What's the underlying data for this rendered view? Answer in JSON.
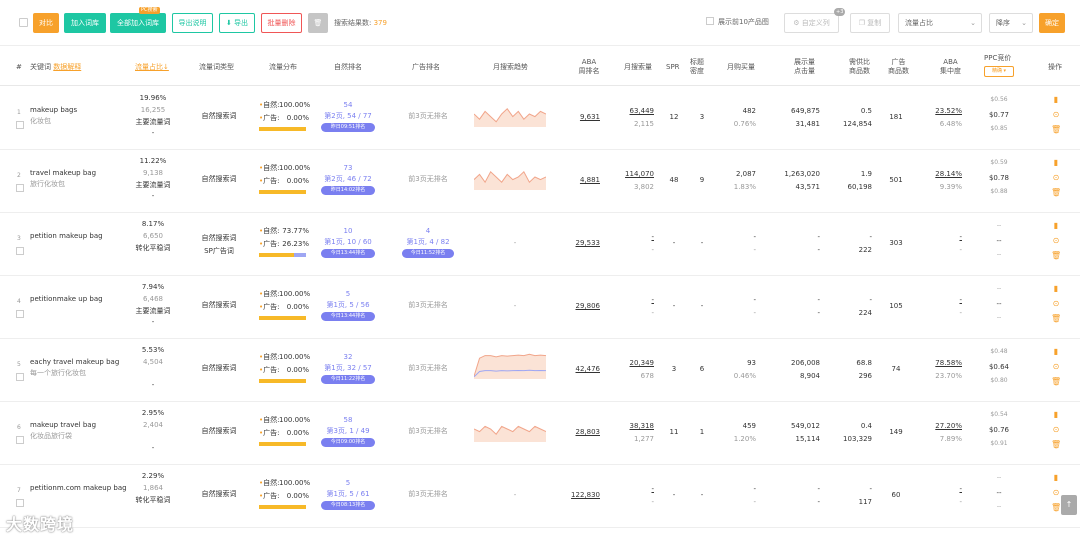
{
  "toolbar": {
    "btn_back": "对比",
    "btn_add_lib": "加入词库",
    "btn_add_all": "全部加入词库",
    "btn_export_note": "导出说明",
    "btn_export": "导出",
    "btn_batch_delete": "批量删除",
    "result_label": "搜索结果数:",
    "result_count": "379",
    "top10_label": "展示前10产品图",
    "btn_custom": "自定义列",
    "custom_badge": "+3",
    "btn_copy": "复制",
    "sort_field": "流量占比",
    "sort_order": "降序",
    "btn_confirm": "确定"
  },
  "headers": {
    "idx": "#",
    "keyword": "关键词",
    "keyword_link": "数据解释",
    "share": "流量占比",
    "share_tag": "PC搜索",
    "share_arrow": "↓",
    "type": "流量词类型",
    "dist": "流量分布",
    "organic_rank": "自然排名",
    "ad_rank": "广告排名",
    "trend": "月搜索趋势",
    "aba1": "ABA",
    "aba2": "周排名",
    "monthly_search": "月搜索量",
    "spr": "SPR",
    "title_density1": "标题",
    "title_density2": "密度",
    "monthly_purchase": "月购买量",
    "impressions1": "展示量",
    "impressions2": "点击量",
    "supply1": "需供比",
    "supply2": "商品数",
    "ad1": "广告",
    "ad2": "商品数",
    "aba_focus1": "ABA",
    "aba_focus2": "集中度",
    "ppc": "PPC竞价",
    "ppc_btn": "精确 ▾",
    "action": "操作"
  },
  "rows": [
    {
      "idx": "1",
      "kw": "makeup bags",
      "kw_cn": "化妆包",
      "share": "19.96%",
      "share_num": "16,255",
      "share_type": "主要流量词",
      "share_extra": "-",
      "type": "自然搜索词",
      "type2": "",
      "nat_label": "自然:",
      "nat": "100.00%",
      "ad_label": "广告:",
      "ad": "0.00%",
      "nat_frac": 1.0,
      "rank_top": "54",
      "rank_mid": "第2页, 54 / 77",
      "rank_pill": "昨日09:51排名",
      "ad_rank_top": "",
      "ad_rank_mid": "前3页无排名",
      "ad_rank_pill": "",
      "aba": "9,631",
      "ms1": "63,449",
      "ms2": "2,115",
      "spr": "12",
      "density": "3",
      "mp1": "482",
      "mp2": "0.76%",
      "im1": "649,875",
      "im2": "31,481",
      "sp1": "0.5",
      "sp2": "124,854",
      "adc": "181",
      "af1": "23.52%",
      "af2": "6.48%",
      "ppc1": "$0.56",
      "ppc2": "$0.77",
      "ppc3": "$0.85",
      "trend": [
        0.5,
        0.3,
        0.6,
        0.4,
        0.2,
        0.5,
        0.7,
        0.4,
        0.6,
        0.3,
        0.5,
        0.4,
        0.6,
        0.5
      ]
    },
    {
      "idx": "2",
      "kw": "travel makeup bag",
      "kw_cn": "旅行化妆包",
      "share": "11.22%",
      "share_num": "9,138",
      "share_type": "主要流量词",
      "share_extra": "-",
      "type": "自然搜索词",
      "type2": "",
      "nat_label": "自然:",
      "nat": "100.00%",
      "ad_label": "广告:",
      "ad": "0.00%",
      "nat_frac": 1.0,
      "rank_top": "73",
      "rank_mid": "第2页, 46 / 72",
      "rank_pill": "昨日14:02排名",
      "ad_rank_top": "",
      "ad_rank_mid": "前3页无排名",
      "ad_rank_pill": "",
      "aba": "4,881",
      "ms1": "114,070",
      "ms2": "3,802",
      "spr": "48",
      "density": "9",
      "mp1": "2,087",
      "mp2": "1.83%",
      "im1": "1,263,020",
      "im2": "43,571",
      "sp1": "1.9",
      "sp2": "60,198",
      "adc": "501",
      "af1": "28.14%",
      "af2": "9.39%",
      "ppc1": "$0.59",
      "ppc2": "$0.78",
      "ppc3": "$0.88",
      "trend": [
        0.4,
        0.6,
        0.3,
        0.7,
        0.5,
        0.3,
        0.6,
        0.4,
        0.5,
        0.7,
        0.3,
        0.5,
        0.4,
        0.5
      ]
    },
    {
      "idx": "3",
      "kw": "petition makeup bag",
      "kw_cn": "",
      "share": "8.17%",
      "share_num": "6,650",
      "share_type": "转化平稳词",
      "share_extra": "",
      "type": "自然搜索词",
      "type2": "SP广告词",
      "nat_label": "自然:",
      "nat": "73.77%",
      "ad_label": "广告:",
      "ad": "26.23%",
      "nat_frac": 0.7377,
      "rank_top": "10",
      "rank_mid": "第1页, 10 / 60",
      "rank_pill": "今日13:44排名",
      "ad_rank_top": "4",
      "ad_rank_mid": "第1页, 4 / 82",
      "ad_rank_pill": "今日11:52排名",
      "aba": "29,533",
      "ms1": "-",
      "ms2": "-",
      "spr": "-",
      "density": "-",
      "mp1": "-",
      "mp2": "-",
      "im1": "-",
      "im2": "-",
      "sp1": "-",
      "sp2": "222",
      "adc": "303",
      "af1": "-",
      "af2": "-",
      "ppc1": "--",
      "ppc2": "--",
      "ppc3": "--",
      "trend": []
    },
    {
      "idx": "4",
      "kw": "petitionmake up bag",
      "kw_cn": "",
      "share": "7.94%",
      "share_num": "6,468",
      "share_type": "主要流量词",
      "share_extra": "-",
      "type": "自然搜索词",
      "type2": "",
      "nat_label": "自然:",
      "nat": "100.00%",
      "ad_label": "广告:",
      "ad": "0.00%",
      "nat_frac": 1.0,
      "rank_top": "5",
      "rank_mid": "第1页, 5 / 56",
      "rank_pill": "今日13:44排名",
      "ad_rank_top": "",
      "ad_rank_mid": "前3页无排名",
      "ad_rank_pill": "",
      "aba": "29,806",
      "ms1": "-",
      "ms2": "-",
      "spr": "-",
      "density": "-",
      "mp1": "-",
      "mp2": "-",
      "im1": "-",
      "im2": "-",
      "sp1": "-",
      "sp2": "224",
      "adc": "105",
      "af1": "-",
      "af2": "-",
      "ppc1": "--",
      "ppc2": "--",
      "ppc3": "--",
      "trend": []
    },
    {
      "idx": "5",
      "kw": "eachy travel makeup bag",
      "kw_cn": "每一个旅行化妆包",
      "share": "5.53%",
      "share_num": "4,504",
      "share_type": "",
      "share_extra": "-",
      "type": "自然搜索词",
      "type2": "",
      "nat_label": "自然:",
      "nat": "100.00%",
      "ad_label": "广告:",
      "ad": "0.00%",
      "nat_frac": 1.0,
      "rank_top": "32",
      "rank_mid": "第1页, 32 / 57",
      "rank_pill": "今日11:22排名",
      "ad_rank_top": "",
      "ad_rank_mid": "前3页无排名",
      "ad_rank_pill": "",
      "aba": "42,476",
      "ms1": "20,349",
      "ms2": "678",
      "spr": "3",
      "density": "6",
      "mp1": "93",
      "mp2": "0.46%",
      "im1": "206,008",
      "im2": "8,904",
      "sp1": "68.8",
      "sp2": "296",
      "adc": "74",
      "af1": "78.58%",
      "af2": "23.70%",
      "ppc1": "$0.48",
      "ppc2": "$0.64",
      "ppc3": "$0.80",
      "trend": [
        0.1,
        0.8,
        0.9,
        0.9,
        0.85,
        0.9,
        0.88,
        0.9,
        0.92,
        0.9,
        0.95,
        0.9,
        0.92,
        0.9
      ]
    },
    {
      "idx": "6",
      "kw": "makeup travel bag",
      "kw_cn": "化妆品旅行袋",
      "share": "2.95%",
      "share_num": "2,404",
      "share_type": "",
      "share_extra": "-",
      "type": "自然搜索词",
      "type2": "",
      "nat_label": "自然:",
      "nat": "100.00%",
      "ad_label": "广告:",
      "ad": "0.00%",
      "nat_frac": 1.0,
      "rank_top": "58",
      "rank_mid": "第3页, 1 / 49",
      "rank_pill": "今日09:00排名",
      "ad_rank_top": "",
      "ad_rank_mid": "前3页无排名",
      "ad_rank_pill": "",
      "aba": "28,803",
      "ms1": "38,318",
      "ms2": "1,277",
      "spr": "11",
      "density": "1",
      "mp1": "459",
      "mp2": "1.20%",
      "im1": "549,012",
      "im2": "15,114",
      "sp1": "0.4",
      "sp2": "103,329",
      "adc": "149",
      "af1": "27.20%",
      "af2": "7.89%",
      "ppc1": "$0.54",
      "ppc2": "$0.76",
      "ppc3": "$0.91",
      "trend": [
        0.5,
        0.4,
        0.6,
        0.5,
        0.3,
        0.6,
        0.5,
        0.4,
        0.6,
        0.5,
        0.4,
        0.6,
        0.5,
        0.4
      ]
    },
    {
      "idx": "7",
      "kw": "petitionm.com makeup bag",
      "kw_cn": "",
      "share": "2.29%",
      "share_num": "1,864",
      "share_type": "转化平稳词",
      "share_extra": "",
      "type": "自然搜索词",
      "type2": "",
      "nat_label": "自然:",
      "nat": "100.00%",
      "ad_label": "广告:",
      "ad": "0.00%",
      "nat_frac": 1.0,
      "rank_top": "5",
      "rank_mid": "第1页, 5 / 61",
      "rank_pill": "今日08:13排名",
      "ad_rank_top": "",
      "ad_rank_mid": "前3页无排名",
      "ad_rank_pill": "",
      "aba": "122,830",
      "ms1": "-",
      "ms2": "-",
      "spr": "-",
      "density": "-",
      "mp1": "-",
      "mp2": "-",
      "im1": "-",
      "im2": "-",
      "sp1": "-",
      "sp2": "117",
      "adc": "60",
      "af1": "-",
      "af2": "-",
      "ppc1": "--",
      "ppc2": "--",
      "ppc3": "--",
      "trend": []
    }
  ],
  "footer": {
    "logo": "大数跨境"
  },
  "colors": {
    "accent": "#f7a12b",
    "green": "#1ec7a3",
    "blue": "#7a7ff0",
    "red": "#f05656"
  }
}
